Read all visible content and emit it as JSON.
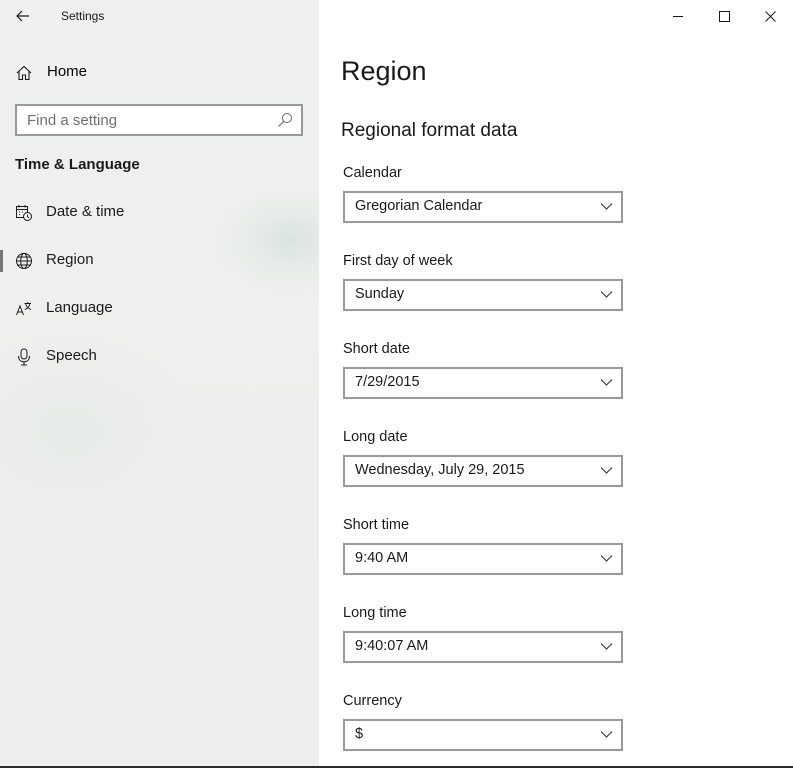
{
  "app": {
    "title": "Settings"
  },
  "sidebar": {
    "home_label": "Home",
    "search": {
      "placeholder": "Find a setting",
      "value": ""
    },
    "section_title": "Time & Language",
    "items": [
      {
        "label": "Date & time",
        "icon": "calendar-clock-icon",
        "selected": false
      },
      {
        "label": "Region",
        "icon": "globe-icon",
        "selected": true
      },
      {
        "label": "Language",
        "icon": "language-icon",
        "selected": false
      },
      {
        "label": "Speech",
        "icon": "microphone-icon",
        "selected": false
      }
    ]
  },
  "main": {
    "title": "Region",
    "subheading": "Regional format data",
    "fields": [
      {
        "label": "Calendar",
        "value": "Gregorian Calendar"
      },
      {
        "label": "First day of week",
        "value": "Sunday"
      },
      {
        "label": "Short date",
        "value": "7/29/2015"
      },
      {
        "label": "Long date",
        "value": "Wednesday, July 29, 2015"
      },
      {
        "label": "Short time",
        "value": "9:40 AM"
      },
      {
        "label": "Long time",
        "value": "9:40:07 AM"
      },
      {
        "label": "Currency",
        "value": "$"
      }
    ]
  },
  "colors": {
    "sidebar_bg": "#eff1f0",
    "border": "#999999",
    "selected_indicator": "#767676"
  }
}
